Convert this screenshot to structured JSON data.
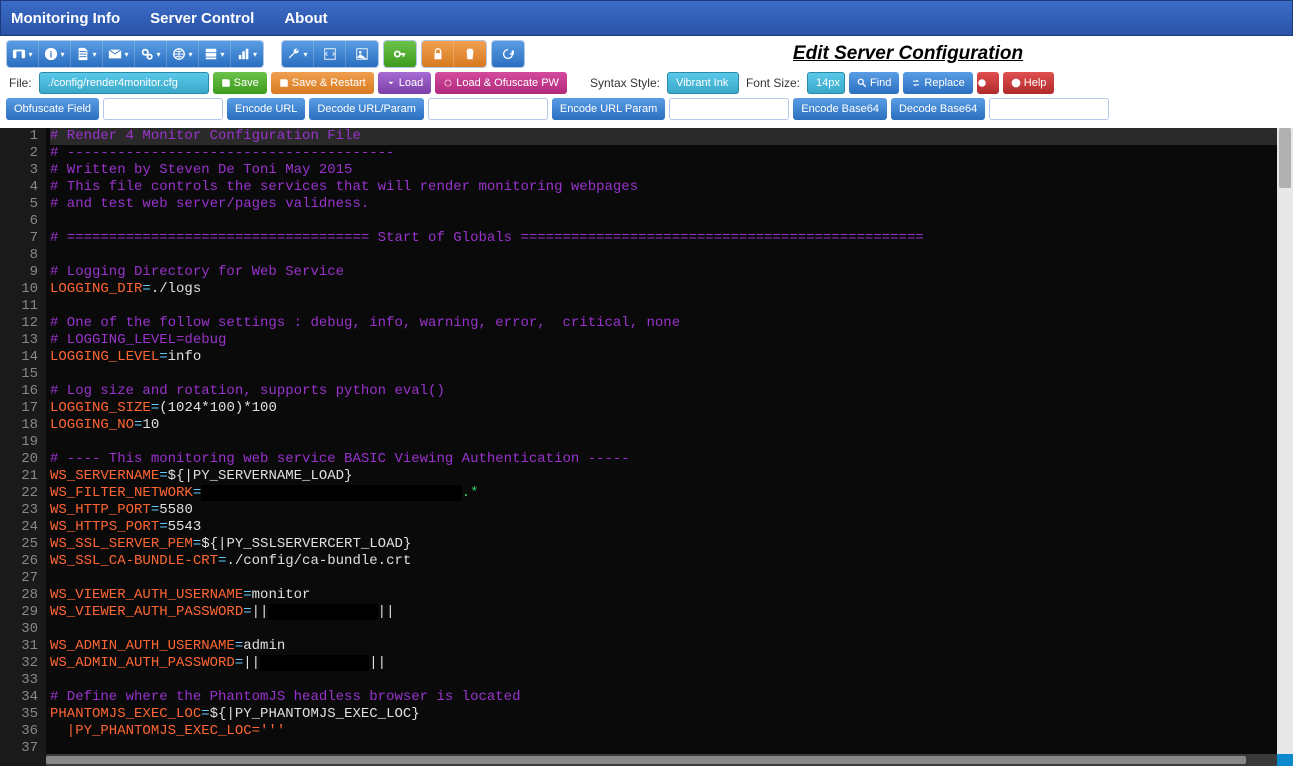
{
  "nav": {
    "monitoring": "Monitoring Info",
    "server_control": "Server Control",
    "about": "About"
  },
  "page_title": "Edit Server Configuration",
  "toolbar_icons": {
    "row1_group1": [
      "binoculars",
      "info",
      "document",
      "mail",
      "gears",
      "globe",
      "server",
      "chart"
    ],
    "row1_group2": [
      "wrench",
      "code",
      "image",
      "key",
      "lock",
      "trash",
      "refresh"
    ]
  },
  "file_row": {
    "file_label": "File:",
    "file_value": "./config/render4monitor.cfg",
    "save": "Save",
    "save_restart": "Save & Restart",
    "load": "Load",
    "load_ofuscate": "Load & Ofuscate PW",
    "syntax_label": "Syntax Style:",
    "syntax_value": "Vibrant Ink",
    "fontsize_label": "Font Size:",
    "fontsize_value": "14px",
    "find": "Find",
    "replace": "Replace",
    "help": "Help"
  },
  "action_row": {
    "obfuscate": "Obfuscate Field",
    "encode_url": "Encode URL",
    "decode_url_param": "Decode URL/Param",
    "encode_url_param": "Encode URL Param",
    "encode_base64": "Encode Base64",
    "decode_base64": "Decode Base64"
  },
  "editor": {
    "lines": [
      {
        "n": 1,
        "type": "comment",
        "text": "# Render 4 Monitor Configuration File",
        "active": true
      },
      {
        "n": 2,
        "type": "comment",
        "text": "# ---------------------------------------"
      },
      {
        "n": 3,
        "type": "comment",
        "text": "# Written by Steven De Toni May 2015"
      },
      {
        "n": 4,
        "type": "comment",
        "text": "# This file controls the services that will render monitoring webpages"
      },
      {
        "n": 5,
        "type": "comment",
        "text": "# and test web server/pages validness."
      },
      {
        "n": 6,
        "type": "blank",
        "text": ""
      },
      {
        "n": 7,
        "type": "comment",
        "text": "# ==================================== Start of Globals ================================================"
      },
      {
        "n": 8,
        "type": "blank",
        "text": ""
      },
      {
        "n": 9,
        "type": "comment",
        "text": "# Logging Directory for Web Service"
      },
      {
        "n": 10,
        "type": "kv",
        "key": "LOGGING_DIR",
        "val": "./logs"
      },
      {
        "n": 11,
        "type": "blank",
        "text": ""
      },
      {
        "n": 12,
        "type": "comment",
        "text": "# One of the follow settings : debug, info, warning, error,  critical, none"
      },
      {
        "n": 13,
        "type": "comment",
        "text": "# LOGGING_LEVEL=debug"
      },
      {
        "n": 14,
        "type": "kv",
        "key": "LOGGING_LEVEL",
        "val": "info"
      },
      {
        "n": 15,
        "type": "blank",
        "text": ""
      },
      {
        "n": 16,
        "type": "comment",
        "text": "# Log size and rotation, supports python eval()"
      },
      {
        "n": 17,
        "type": "kv",
        "key": "LOGGING_SIZE",
        "val": "(1024*100)*100"
      },
      {
        "n": 18,
        "type": "kv",
        "key": "LOGGING_NO",
        "val": "10"
      },
      {
        "n": 19,
        "type": "blank",
        "text": ""
      },
      {
        "n": 20,
        "type": "comment",
        "text": "# ---- This monitoring web service BASIC Viewing Authentication -----"
      },
      {
        "n": 21,
        "type": "kv",
        "key": "WS_SERVERNAME",
        "val": "${|PY_SERVERNAME_LOAD}"
      },
      {
        "n": 22,
        "type": "kvmask",
        "key": "WS_FILTER_NETWORK",
        "pre": "",
        "mask": "                               ",
        "post": ".*"
      },
      {
        "n": 23,
        "type": "kv",
        "key": "WS_HTTP_PORT",
        "val": "5580"
      },
      {
        "n": 24,
        "type": "kv",
        "key": "WS_HTTPS_PORT",
        "val": "5543"
      },
      {
        "n": 25,
        "type": "kv",
        "key": "WS_SSL_SERVER_PEM",
        "val": "${|PY_SSLSERVERCERT_LOAD}"
      },
      {
        "n": 26,
        "type": "kv",
        "key": "WS_SSL_CA-BUNDLE-CRT",
        "val": "./config/ca-bundle.crt"
      },
      {
        "n": 27,
        "type": "blank",
        "text": ""
      },
      {
        "n": 28,
        "type": "kv",
        "key": "WS_VIEWER_AUTH_USERNAME",
        "val": "monitor"
      },
      {
        "n": 29,
        "type": "kvpipe",
        "key": "WS_VIEWER_AUTH_PASSWORD",
        "mid": "             "
      },
      {
        "n": 30,
        "type": "blank",
        "text": ""
      },
      {
        "n": 31,
        "type": "kv",
        "key": "WS_ADMIN_AUTH_USERNAME",
        "val": "admin"
      },
      {
        "n": 32,
        "type": "kvpipe",
        "key": "WS_ADMIN_AUTH_PASSWORD",
        "mid": "             "
      },
      {
        "n": 33,
        "type": "blank",
        "text": ""
      },
      {
        "n": 34,
        "type": "comment",
        "text": "# Define where the PhantomJS headless browser is located"
      },
      {
        "n": 35,
        "type": "kv",
        "key": "PHANTOMJS_EXEC_LOC",
        "val": "${|PY_PHANTOMJS_EXEC_LOC}"
      },
      {
        "n": 36,
        "type": "raw",
        "text": "  |PY_PHANTOMJS_EXEC_LOC='''"
      },
      {
        "n": 37,
        "type": "blank",
        "text": ""
      }
    ]
  }
}
